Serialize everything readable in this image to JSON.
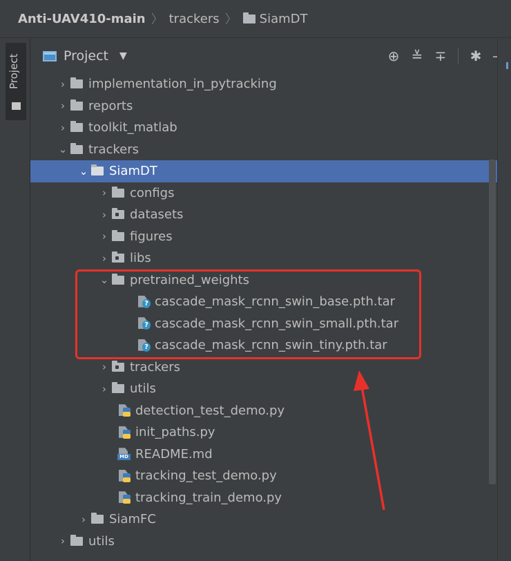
{
  "breadcrumb": {
    "root": "Anti-UAV410-main",
    "middle": "trackers",
    "current": "SiamDT"
  },
  "left_strip": {
    "project_tab_label": "Project"
  },
  "project_header": {
    "title": "Project",
    "dropdown_icon": "chevron-down-icon",
    "tools": [
      "locate-icon",
      "expand-all-icon",
      "collapse-all-icon",
      "gear-icon",
      "minimize-icon"
    ]
  },
  "tree": {
    "rows": [
      {
        "label": "implementation_in_pytracking",
        "icon": "folder-icon",
        "expanded": false
      },
      {
        "label": "reports",
        "icon": "folder-icon",
        "expanded": false
      },
      {
        "label": "toolkit_matlab",
        "icon": "folder-icon",
        "expanded": false
      },
      {
        "label": "trackers",
        "icon": "folder-icon",
        "expanded": true
      },
      {
        "label": "SiamDT",
        "icon": "folder-icon",
        "expanded": true,
        "selected": true
      },
      {
        "label": "configs",
        "icon": "folder-icon",
        "expanded": false
      },
      {
        "label": "datasets",
        "icon": "package-folder-icon",
        "expanded": false
      },
      {
        "label": "figures",
        "icon": "folder-icon",
        "expanded": false
      },
      {
        "label": "libs",
        "icon": "package-folder-icon",
        "expanded": false
      },
      {
        "label": "pretrained_weights",
        "icon": "folder-icon",
        "expanded": true
      },
      {
        "label": "cascade_mask_rcnn_swin_base.pth.tar",
        "icon": "unknown-file-icon"
      },
      {
        "label": "cascade_mask_rcnn_swin_small.pth.tar",
        "icon": "unknown-file-icon"
      },
      {
        "label": "cascade_mask_rcnn_swin_tiny.pth.tar",
        "icon": "unknown-file-icon"
      },
      {
        "label": "trackers",
        "icon": "package-folder-icon",
        "expanded": false
      },
      {
        "label": "utils",
        "icon": "folder-icon",
        "expanded": false
      },
      {
        "label": "detection_test_demo.py",
        "icon": "python-file-icon"
      },
      {
        "label": "init_paths.py",
        "icon": "python-file-icon"
      },
      {
        "label": "README.md",
        "icon": "markdown-file-icon"
      },
      {
        "label": "tracking_test_demo.py",
        "icon": "python-file-icon"
      },
      {
        "label": "tracking_train_demo.py",
        "icon": "python-file-icon"
      },
      {
        "label": "SiamFC",
        "icon": "folder-icon",
        "expanded": false
      },
      {
        "label": "utils",
        "icon": "folder-icon",
        "expanded": false
      }
    ]
  },
  "annotation": {
    "box_color": "#e8312a",
    "arrow_color": "#e8312a"
  },
  "colors": {
    "background": "#3c3f41",
    "selection": "#4b6eaf",
    "text": "#bbbbbb"
  }
}
